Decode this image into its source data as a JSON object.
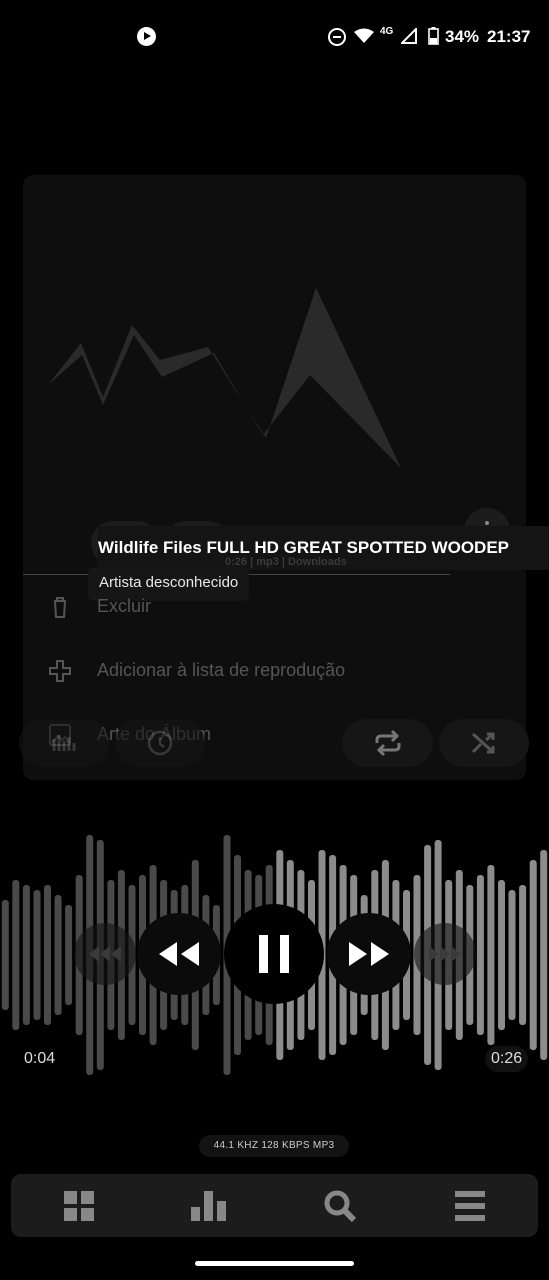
{
  "status_bar": {
    "network": "4G",
    "battery": "34%",
    "time": "21:37"
  },
  "track": {
    "title": "Wildlife Files FULL HD GREAT SPOTTED WOODEP",
    "info": "0:26 | mp3 | Downloads",
    "artist": "Artista desconhecido"
  },
  "context_menu": {
    "items": [
      {
        "label": "Excluir",
        "icon": "trash-icon"
      },
      {
        "label": "Adicionar à lista de reprodução",
        "icon": "plus-icon"
      },
      {
        "label": "Arte do Álbum",
        "icon": "image-icon"
      }
    ]
  },
  "player": {
    "position": "0:04",
    "duration": "0:26",
    "progress_fraction": 0.154,
    "codec_info": "44.1 KHZ  128 KBPS  MP3"
  },
  "bottom_nav": {
    "items": [
      "grid-icon",
      "bar-chart-icon",
      "search-icon",
      "menu-icon"
    ]
  },
  "colors": {
    "background": "#000000",
    "panel": "#0e0e0e",
    "wave_played": "#4a4a4a",
    "wave_unplayed": "#8c8c8c"
  }
}
